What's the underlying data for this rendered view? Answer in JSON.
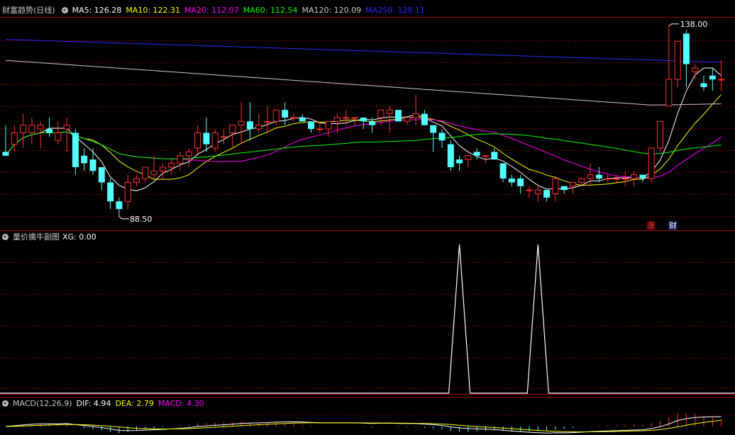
{
  "main_panel": {
    "title": "财富趋势(日线)",
    "indicators": [
      {
        "label": "MA5: 126.28",
        "color": "#ffffff"
      },
      {
        "label": "MA10: 122.31",
        "color": "#ffff00"
      },
      {
        "label": "MA20: 112.07",
        "color": "#ff00ff"
      },
      {
        "label": "MA60: 112.54",
        "color": "#00ff00"
      },
      {
        "label": "MA120: 120.09",
        "color": "#cccccc"
      },
      {
        "label": "MA250: 128.11",
        "color": "#2a2aff"
      }
    ],
    "high_label": "138.00",
    "low_label": "88.50",
    "badge_zhang": "涨",
    "badge_cai": "财"
  },
  "sub_panel": {
    "title": "量价擒牛副图",
    "xg_label": "XG: 0.00"
  },
  "macd_panel": {
    "title": "MACD(12,26,9)",
    "dif": "DIF: 4.94",
    "dea": "DEA: 2.79",
    "macd": "MACD: 4.30"
  },
  "colors": {
    "up": "#ff3232",
    "down": "#54ffff",
    "grid": "#8a0000",
    "divider": "#a00000",
    "xg_line": "#ffffff",
    "macd_up": "#ff3232",
    "macd_down": "#54ffff"
  },
  "chart_data": {
    "type": "candlestick",
    "ylim": [
      85,
      140
    ],
    "candles": [
      [
        105,
        112,
        104,
        104
      ],
      [
        107,
        112,
        105,
        110
      ],
      [
        110,
        115,
        106,
        112
      ],
      [
        110,
        114,
        107,
        112
      ],
      [
        111,
        113,
        106,
        112
      ],
      [
        111,
        114,
        109,
        110
      ],
      [
        108,
        113,
        107,
        110
      ],
      [
        111,
        114,
        105,
        112
      ],
      [
        110,
        111,
        99,
        101
      ],
      [
        104,
        106,
        100,
        102
      ],
      [
        103,
        106,
        99,
        100
      ],
      [
        101,
        101,
        95,
        97
      ],
      [
        97,
        98,
        90,
        92
      ],
      [
        92,
        93,
        88,
        90
      ],
      [
        92,
        99,
        90,
        97
      ],
      [
        97,
        99,
        96,
        98
      ],
      [
        98,
        101,
        97,
        101
      ],
      [
        99,
        104,
        98,
        100
      ],
      [
        100,
        102,
        98,
        101
      ],
      [
        101,
        103,
        99,
        102
      ],
      [
        102,
        105,
        100,
        104
      ],
      [
        104,
        106,
        101,
        105
      ],
      [
        106,
        112,
        104,
        110
      ],
      [
        110,
        114,
        105,
        107
      ],
      [
        106,
        111,
        105,
        110
      ],
      [
        109,
        111,
        107,
        109
      ],
      [
        110,
        112,
        106,
        112
      ],
      [
        112,
        118,
        107,
        113
      ],
      [
        113,
        118,
        108,
        111
      ],
      [
        111,
        115,
        110,
        112
      ],
      [
        113,
        117,
        110,
        113
      ],
      [
        113,
        116,
        112,
        116
      ],
      [
        116,
        118,
        112,
        114
      ],
      [
        114,
        115,
        113,
        114
      ],
      [
        114,
        115,
        113,
        113
      ],
      [
        113,
        112,
        110,
        111
      ],
      [
        111,
        113,
        110,
        111
      ],
      [
        111,
        112,
        109,
        113
      ],
      [
        113,
        115,
        110,
        114
      ],
      [
        114,
        116,
        112,
        114
      ],
      [
        114,
        114,
        112,
        114
      ],
      [
        114,
        114,
        111,
        113
      ],
      [
        113,
        114,
        110,
        112
      ],
      [
        114,
        114,
        112,
        116
      ],
      [
        115,
        117,
        110,
        116
      ],
      [
        116,
        115,
        113,
        113
      ],
      [
        113,
        114,
        112,
        114
      ],
      [
        114,
        120,
        112,
        115
      ],
      [
        115,
        116,
        112,
        112
      ],
      [
        112,
        112,
        105,
        110
      ],
      [
        110,
        111,
        106,
        108
      ],
      [
        107,
        108,
        100,
        101
      ],
      [
        103,
        104,
        100,
        102
      ],
      [
        103,
        104,
        101,
        104
      ],
      [
        105,
        106,
        103,
        104
      ],
      [
        104,
        104,
        102,
        104
      ],
      [
        105,
        106,
        103,
        103
      ],
      [
        102,
        101,
        97,
        98
      ],
      [
        98,
        99,
        96,
        97
      ],
      [
        98,
        99,
        94,
        96
      ],
      [
        95,
        96,
        93,
        95
      ],
      [
        94,
        96,
        92,
        95
      ],
      [
        95,
        94,
        92,
        93
      ],
      [
        94,
        97,
        92,
        98
      ],
      [
        96,
        96,
        94,
        95
      ],
      [
        96,
        97,
        94,
        97
      ],
      [
        97,
        98,
        96,
        98
      ],
      [
        98,
        102,
        96,
        99
      ],
      [
        99,
        101,
        97,
        98
      ],
      [
        98,
        99,
        97,
        98
      ],
      [
        98,
        99,
        97,
        98
      ],
      [
        98,
        100,
        96,
        98
      ],
      [
        98,
        100,
        96,
        99
      ],
      [
        99,
        99,
        97,
        98
      ],
      [
        98,
        106,
        97,
        106
      ],
      [
        106,
        113,
        105,
        113
      ],
      [
        117,
        138,
        117,
        124
      ],
      [
        124,
        133,
        122,
        134
      ],
      [
        136,
        137,
        122,
        128
      ],
      [
        126,
        128,
        124,
        127
      ],
      [
        123,
        125,
        121,
        122
      ],
      [
        125,
        127,
        121,
        124
      ],
      [
        124,
        129,
        121,
        124
      ]
    ],
    "xg_spikes": [
      52,
      61
    ]
  }
}
